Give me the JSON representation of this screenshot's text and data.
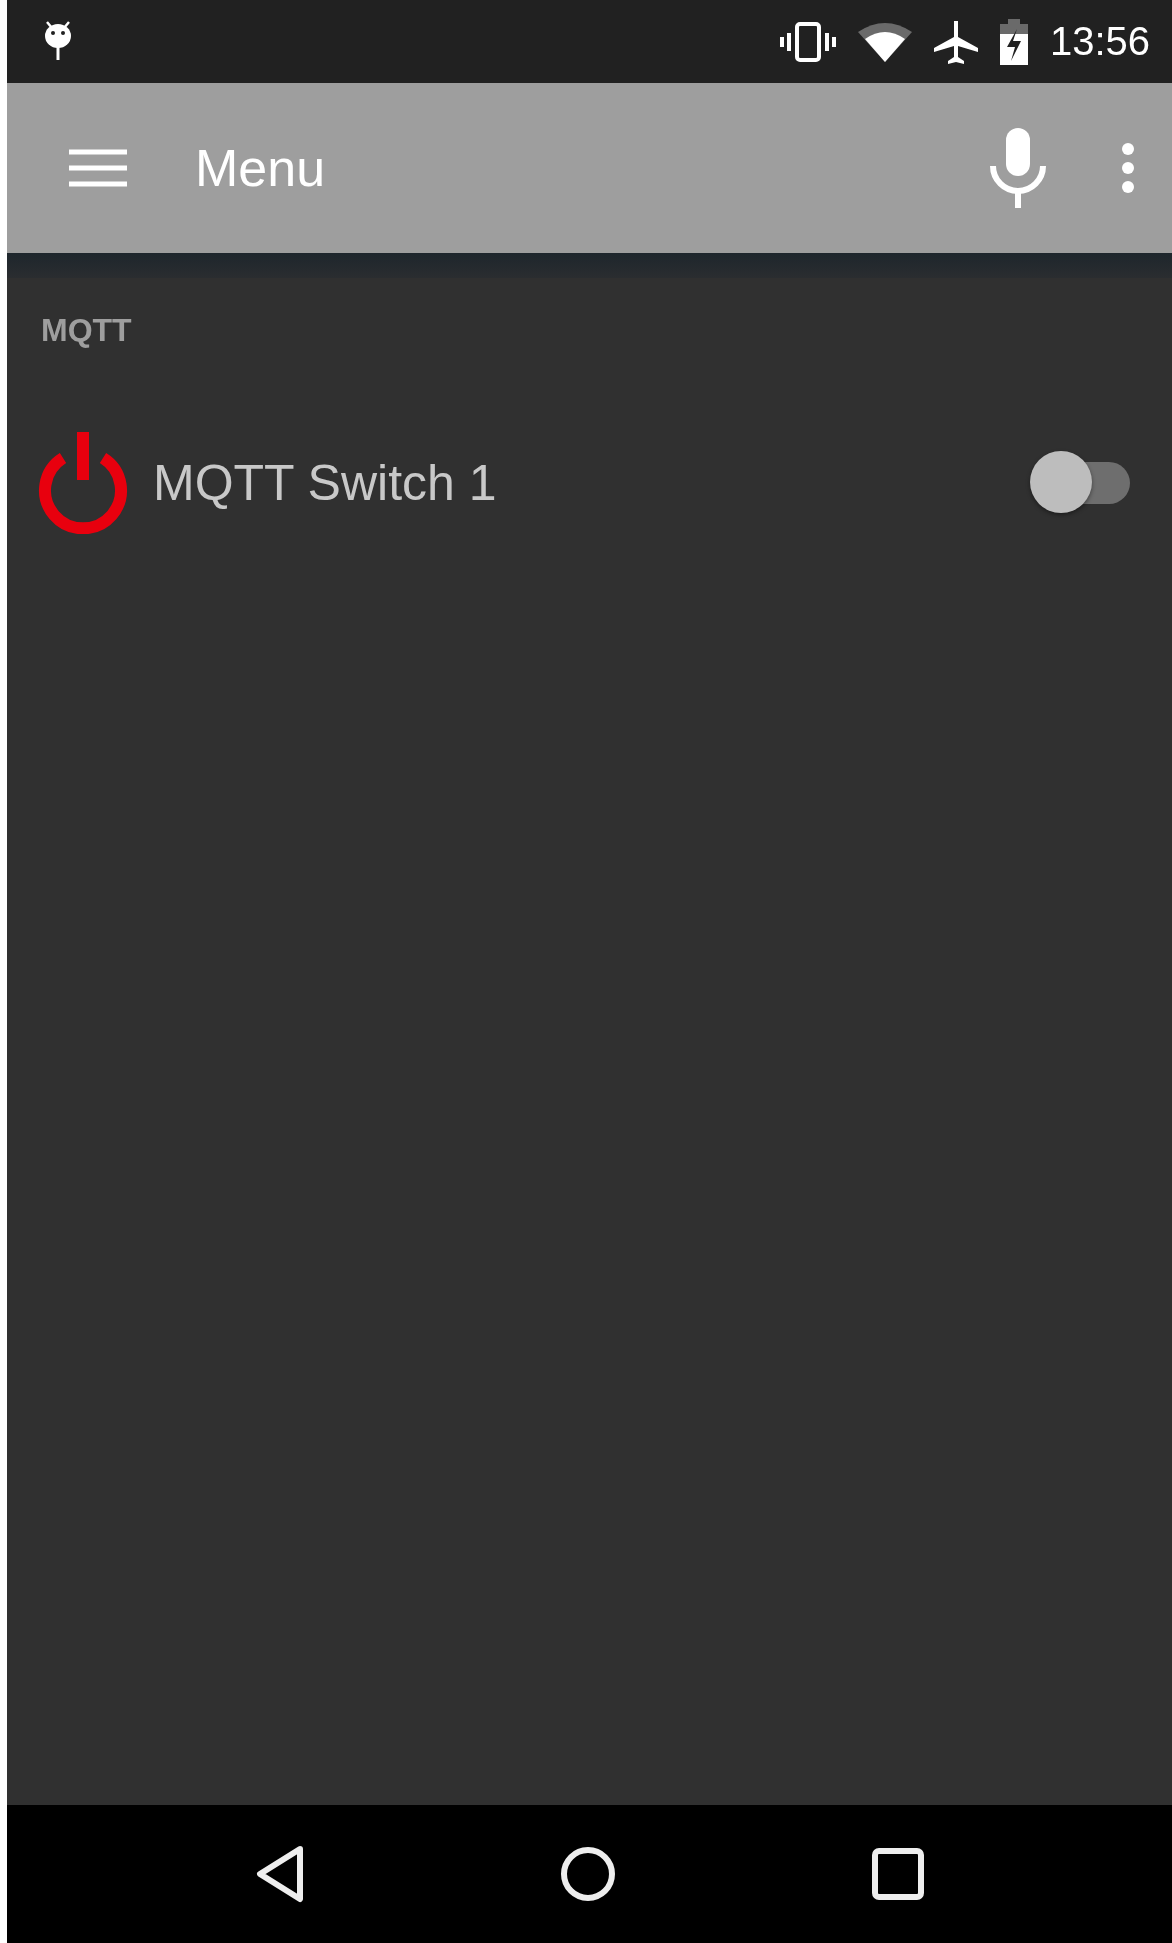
{
  "status_bar": {
    "time": "13:56"
  },
  "toolbar": {
    "title": "Menu"
  },
  "sections": [
    {
      "title": "MQTT",
      "items": [
        {
          "label": "MQTT Switch 1",
          "on": false
        }
      ]
    }
  ]
}
